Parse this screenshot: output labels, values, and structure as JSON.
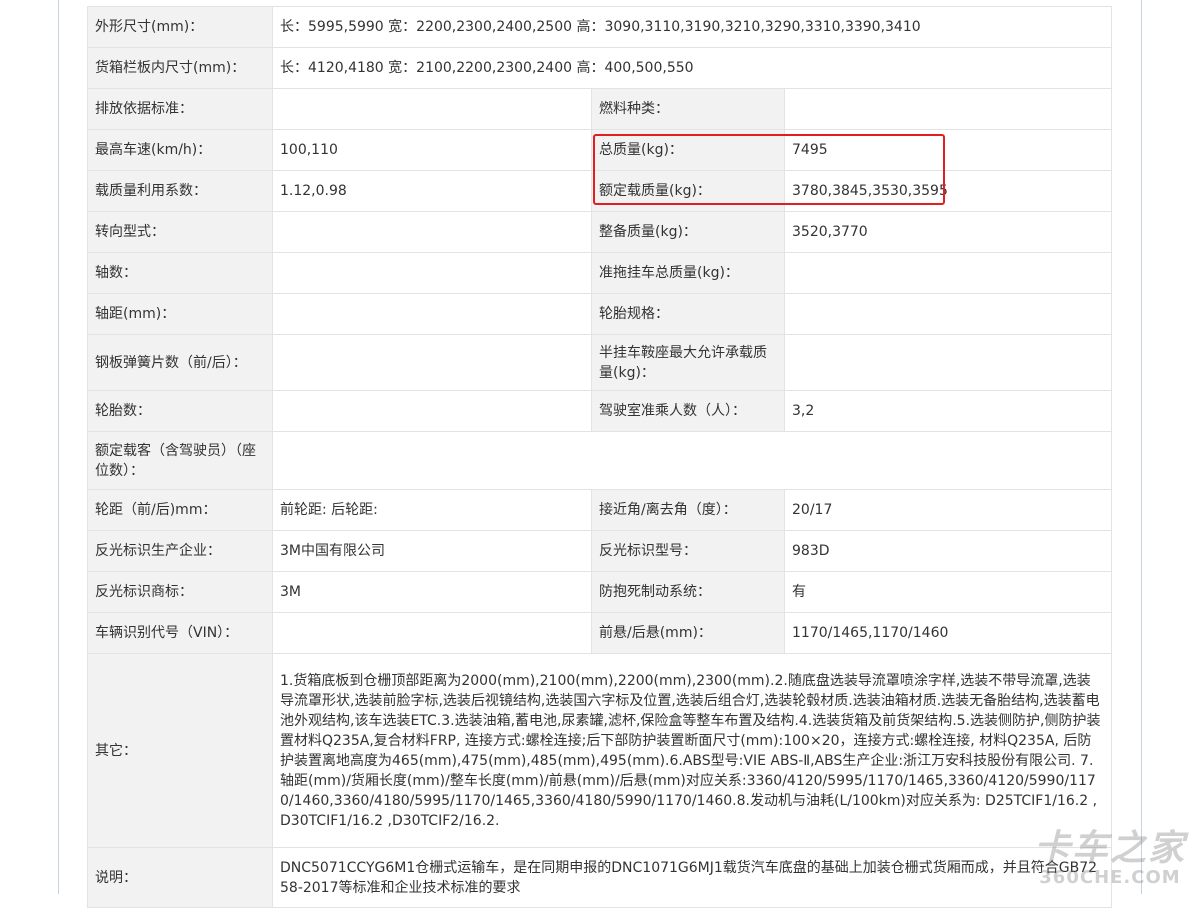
{
  "rows": [
    {
      "l1": "外形尺寸(mm)：",
      "v1": "长：5995,5990 宽：2200,2300,2400,2500 高：3090,3110,3190,3210,3290,3310,3390,3410"
    },
    {
      "l1": "货箱栏板内尺寸(mm)：",
      "v1": "长：4120,4180 宽：2100,2200,2300,2400 高：400,500,550"
    },
    {
      "l1": "排放依据标准：",
      "v1": "",
      "l2": "燃料种类：",
      "v2": ""
    },
    {
      "l1": "最高车速(km/h)：",
      "v1": "100,110",
      "l2": "总质量(kg)：",
      "v2": "7495"
    },
    {
      "l1": "载质量利用系数：",
      "v1": "1.12,0.98",
      "l2": "额定载质量(kg)：",
      "v2": "3780,3845,3530,3595"
    },
    {
      "l1": "转向型式：",
      "v1": "",
      "l2": "整备质量(kg)：",
      "v2": "3520,3770"
    },
    {
      "l1": "轴数：",
      "v1": "",
      "l2": "准拖挂车总质量(kg)：",
      "v2": ""
    },
    {
      "l1": "轴距(mm)：",
      "v1": "",
      "l2": "轮胎规格：",
      "v2": ""
    },
    {
      "l1": "钢板弹簧片数（前/后）：",
      "v1": "",
      "l2": "半挂车鞍座最大允许承载质量(kg)：",
      "v2": ""
    },
    {
      "l1": "轮胎数：",
      "v1": "",
      "l2": "驾驶室准乘人数（人）：",
      "v2": "3,2"
    },
    {
      "l1": "额定载客（含驾驶员）（座位数）：",
      "v1": ""
    },
    {
      "l1": "轮距（前/后)mm：",
      "v1": "前轮距: 后轮距:",
      "l2": "接近角/离去角（度）：",
      "v2": "20/17"
    },
    {
      "l1": "反光标识生产企业：",
      "v1": "3M中国有限公司",
      "l2": "反光标识型号：",
      "v2": "983D"
    },
    {
      "l1": "反光标识商标：",
      "v1": "3M",
      "l2": "防抱死制动系统：",
      "v2": "有"
    },
    {
      "l1": "车辆识别代号（VIN）：",
      "v1": "",
      "l2": "前悬/后悬(mm)：",
      "v2": "1170/1465,1170/1460"
    }
  ],
  "other": {
    "label": "其它：",
    "text": "1.货箱底板到仓栅顶部距离为2000(mm),2100(mm),2200(mm),2300(mm).2.随底盘选装导流罩喷涂字样,选装不带导流罩,选装导流罩形状,选装前脸字标,选装后视镜结构,选装国六字标及位置,选装后组合灯,选装轮毂材质.选装油箱材质.选装无备胎结构,选装蓄电池外观结构,该车选装ETC.3.选装油箱,蓄电池,尿素罐,滤杯,保险盒等整车布置及结构.4.选装货箱及前货架结构.5.选装侧防护,侧防护装置材料Q235A,复合材料FRP, 连接方式:螺栓连接;后下部防护装置断面尺寸(mm):100×20，连接方式:螺栓连接, 材料Q235A, 后防护装置离地高度为465(mm),475(mm),485(mm),495(mm).6.ABS型号:VIE ABS-Ⅱ,ABS生产企业:浙江万安科技股份有限公司. 7.轴距(mm)/货厢长度(mm)/整车长度(mm)/前悬(mm)/后悬(mm)对应关系:3360/4120/5995/1170/1465,3360/4120/5990/1170/1460,3360/4180/5995/1170/1465,3360/4180/5990/1170/1460.8.发动机与油耗(L/100km)对应关系为: D25TCIF1/16.2 ,D30TCIF1/16.2 ,D30TCIF2/16.2."
  },
  "desc": {
    "label": "说明：",
    "text": "DNC5071CCYG6M1仓栅式运输车，是在同期申报的DNC1071G6MJ1载货汽车底盘的基础上加装仓栅式货厢而成，并且符合GB7258-2017等标准和企业技术标准的要求"
  },
  "watermark": {
    "main": "卡车之家",
    "sub": "360CHE.COM"
  },
  "colors": {
    "label_bg": "#f2f2f2",
    "highlight": "#e02020",
    "frame": "#c6d3e2"
  }
}
